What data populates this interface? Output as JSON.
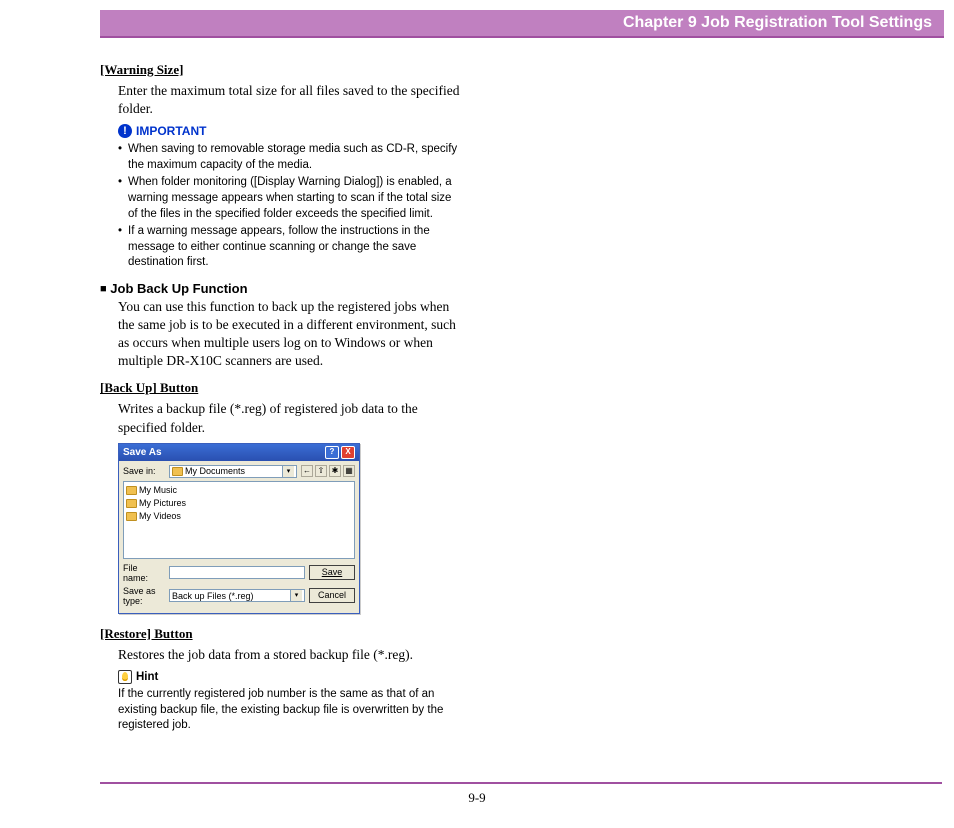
{
  "header": {
    "chapter_title": "Chapter 9   Job Registration Tool Settings"
  },
  "sections": {
    "warning_size": {
      "heading": "[Warning Size]",
      "body": "Enter the maximum total size for all files saved to the specified folder."
    },
    "important": {
      "label": "IMPORTANT",
      "bullets": [
        "When saving to removable storage media such as CD-R, specify the maximum capacity of the media.",
        "When folder monitoring ([Display Warning Dialog]) is enabled, a warning message appears when starting to scan if the total size of the files in the specified folder exceeds the specified limit.",
        "If a warning message appears, follow the instructions in the message to either continue scanning or change the save destination first."
      ]
    },
    "job_backup": {
      "heading": "Job Back Up Function",
      "body": "You can use this function to back up the registered jobs when the same job is to be executed in a different environment, such as occurs when multiple users log on to Windows or when multiple DR-X10C scanners are used."
    },
    "backup_btn": {
      "heading": "[Back Up] Button",
      "body": "Writes a backup file (*.reg) of registered job data to the specified folder."
    },
    "restore_btn": {
      "heading": "[Restore] Button",
      "body": "Restores the job data from a stored backup file (*.reg)."
    },
    "hint": {
      "label": "Hint",
      "body": "If the currently registered job number is the same as that of an existing backup file, the existing backup file is overwritten by the registered job."
    }
  },
  "dialog": {
    "title": "Save As",
    "save_in_label": "Save in:",
    "save_in_value": "My Documents",
    "list_items": [
      "My Music",
      "My Pictures",
      "My Videos"
    ],
    "file_name_label": "File name:",
    "file_name_value": "",
    "save_as_type_label": "Save as type:",
    "save_as_type_value": "Back up Files (*.reg)",
    "save_button": "Save",
    "cancel_button": "Cancel"
  },
  "footer": {
    "page_number": "9-9"
  }
}
